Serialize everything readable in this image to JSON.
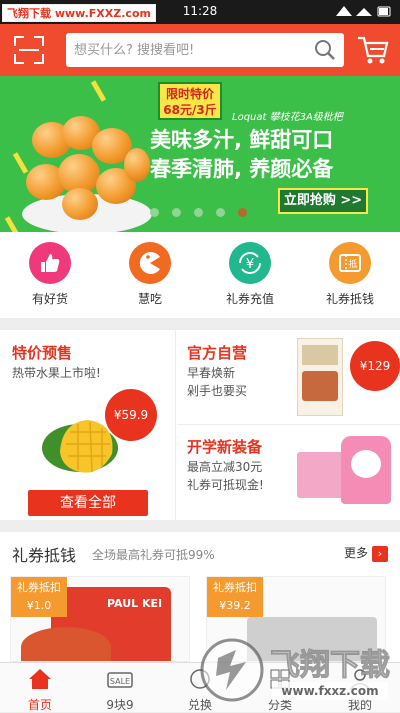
{
  "status_bar": {
    "watermark": "飞翔下载 www.FXXZ.com",
    "time": "11:28"
  },
  "header": {
    "search_placeholder": "想买什么? 搜搜看吧!"
  },
  "banner": {
    "promo_tag_line1": "限时特价",
    "promo_tag_line2": "68元/3斤",
    "brand": "Loquat 攀枝花3A级枇杷",
    "headline_1": "美味多汁, 鲜甜可口",
    "headline_2": "春季清肺, 养颜必备",
    "cta": "立即抢购 >>"
  },
  "categories": [
    {
      "label": "有好货",
      "color": "#f0397a",
      "icon": "thumbs-up-icon"
    },
    {
      "label": "慧吃",
      "color": "#f06a21",
      "icon": "pacman-icon"
    },
    {
      "label": "礼券充值",
      "color": "#21b88f",
      "icon": "yen-refresh-icon"
    },
    {
      "label": "礼券抵钱",
      "color": "#f59a2f",
      "icon": "coupon-icon"
    }
  ],
  "deals": {
    "presale_title": "特价预售",
    "presale_sub": "热带水果上市啦!",
    "presale_price": "¥59.9",
    "view_all": "查看全部",
    "official_title": "官方自营",
    "official_sub1": "早春焕新",
    "official_sub2": "剁手也要买",
    "official_price": "¥129",
    "school_title": "开学新装备",
    "school_sub1": "最高立减30元",
    "school_sub2": "礼券可抵现金!"
  },
  "coupons": {
    "title": "礼券抵钱",
    "subtitle": "全场最高礼券可抵99%",
    "more": "更多",
    "cards": [
      {
        "tag": "礼券抵扣",
        "price": "¥1.0",
        "brand": "PAUL KEI"
      },
      {
        "tag": "礼券抵扣",
        "price": "¥39.2"
      }
    ]
  },
  "tabbar": {
    "tabs": [
      {
        "label": "首页"
      },
      {
        "label": "9块9",
        "badge": "SALE"
      },
      {
        "label": "兑换"
      },
      {
        "label": "分类"
      },
      {
        "label": "我的"
      }
    ]
  },
  "overlay": {
    "name": "飞翔下载",
    "url": "www.fxxz.com"
  },
  "colors": {
    "accent": "#f04b2e",
    "banner": "#3cbf48",
    "price": "#e8341f"
  }
}
